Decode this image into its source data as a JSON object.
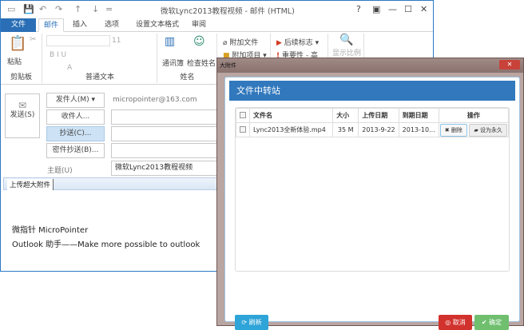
{
  "window": {
    "title": "微软Lync2013教程视频 - 邮件 (HTML)",
    "controls": [
      "?",
      "▣",
      "—",
      "☐",
      "✕"
    ]
  },
  "qat": [
    "▭",
    "💾",
    "↶",
    "↷",
    "↑",
    "↓",
    "="
  ],
  "tabs": [
    "文件",
    "邮件",
    "插入",
    "选项",
    "设置文本格式",
    "审阅"
  ],
  "ribbon": {
    "clipboard": {
      "label": "剪贴板",
      "paste": "粘贴"
    },
    "text": {
      "label": "普通文本",
      "font_size": "11",
      "row2": "B  I  U",
      "row3": "A"
    },
    "names": {
      "label": "姓名",
      "address_book": "通讯簿",
      "check_names": "检查姓名"
    },
    "include": {
      "attach_file": "附加文件",
      "attach_item": "附加项目 ▾"
    },
    "tags": {
      "follow_up": "后续标志 ▾",
      "importance": "重要性 - 高"
    },
    "zoom": "显示比例"
  },
  "compose": {
    "send": "发送(S)",
    "from_btn": "发件人(M) ▾",
    "from_value": "micropointer@163.com",
    "to_btn": "收件人...",
    "cc_btn": "抄送(C)...",
    "bcc_btn": "密件抄送(B)...",
    "subject_label": "主题(U)",
    "subject_value": "微软Lync2013教程视频",
    "upload_tab": "上传超大附件",
    "body_line1": "微指针 MicroPointer",
    "body_line2": "Outlook 助手——Make more possible to outlook"
  },
  "dialog": {
    "title": "大附件",
    "close": "✕",
    "header": "文件中转站",
    "columns": [
      "文件名",
      "大小",
      "上传日期",
      "到期日期",
      "操作"
    ],
    "rows": [
      {
        "name": "Lync2013全新体验.mp4",
        "size": "35 M",
        "upload": "2013-9-22",
        "expire": "2013-10...",
        "delete": "删除",
        "permanent": "设为永久"
      }
    ],
    "refresh": "刷新",
    "cancel": "取消",
    "ok": "确定"
  },
  "colors": {
    "accent": "#2a6fb6",
    "dialog_header": "#3178bd",
    "refresh": "#2fa4d8",
    "cancel": "#d2322d",
    "ok": "#6fbf6f"
  }
}
